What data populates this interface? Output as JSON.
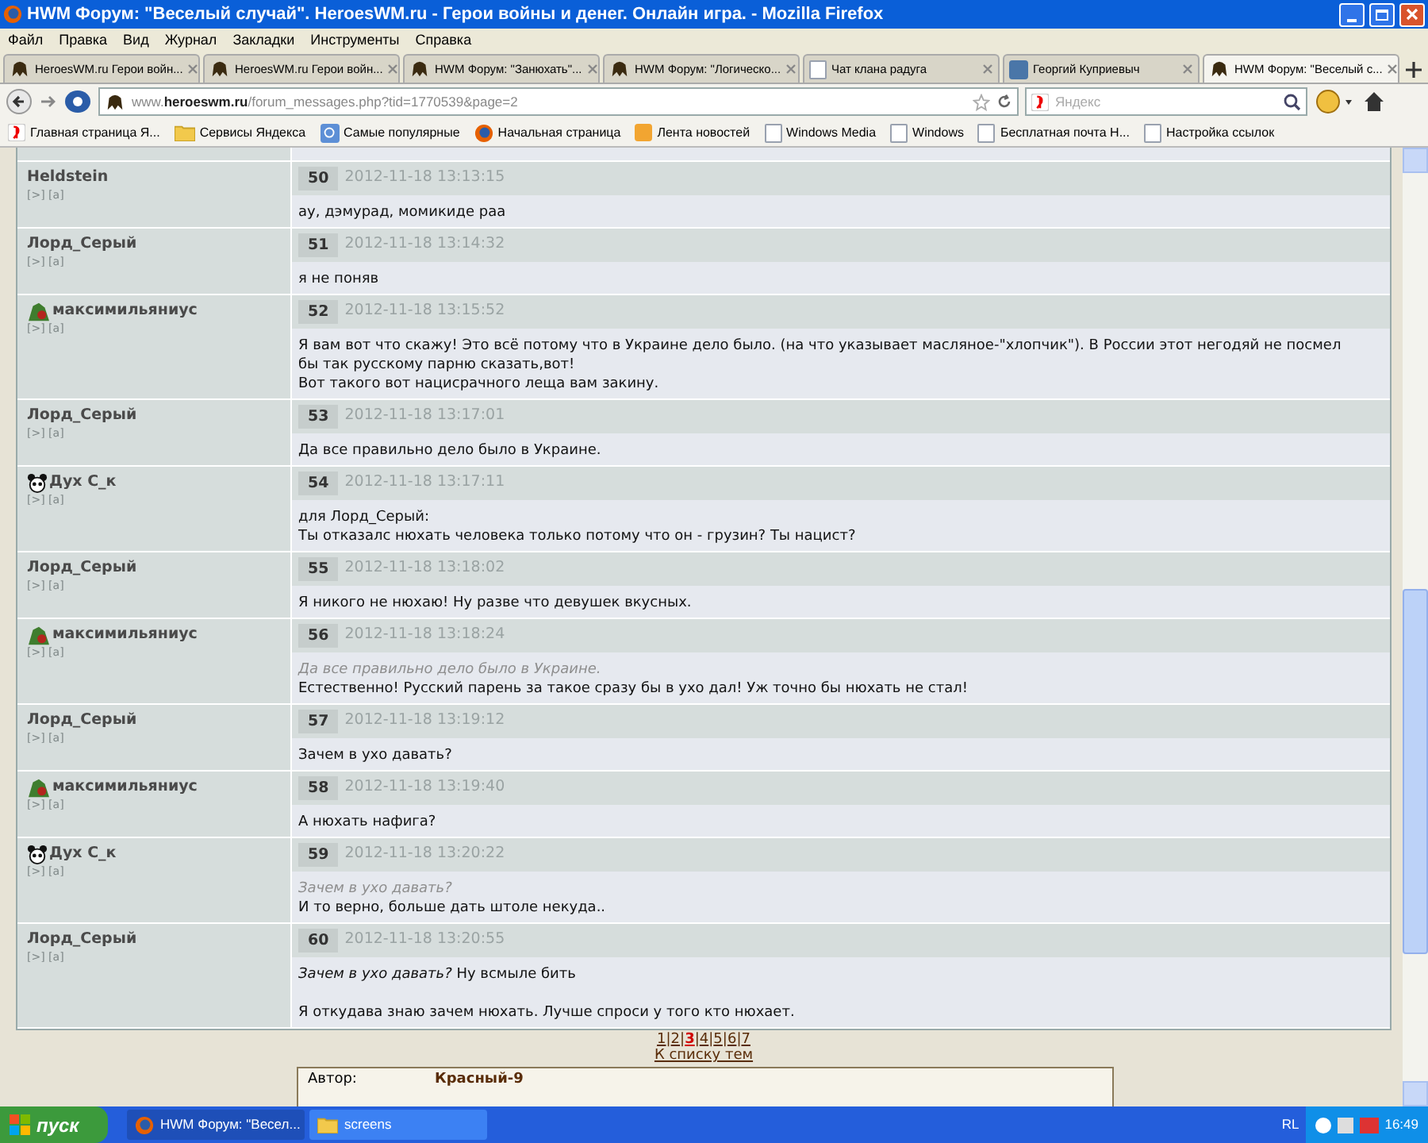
{
  "window": {
    "title": "HWM Форум: \"Веселый случай\". HeroesWM.ru - Герои войны и денег. Онлайн игра. - Mozilla Firefox"
  },
  "menu": [
    "Файл",
    "Правка",
    "Вид",
    "Журнал",
    "Закладки",
    "Инструменты",
    "Справка"
  ],
  "tabs": [
    {
      "label": "HeroesWM.ru Герои войн...",
      "kind": "game",
      "selected": false
    },
    {
      "label": "HeroesWM.ru Герои войн...",
      "kind": "game",
      "selected": false
    },
    {
      "label": "HWM Форум: \"Занюхать\"...",
      "kind": "game",
      "selected": false
    },
    {
      "label": "HWM Форум: \"Логическо...",
      "kind": "game",
      "selected": false
    },
    {
      "label": "Чат клана радуга",
      "kind": "blank",
      "selected": false
    },
    {
      "label": "Георгий Куприевыч",
      "kind": "vk",
      "selected": false
    },
    {
      "label": "HWM Форум: \"Веселый с...",
      "kind": "game",
      "selected": true
    }
  ],
  "address": {
    "domain_prefix": "www.",
    "domain": "heroeswm.ru",
    "path": "/forum_messages.php?tid=1770539&page=2"
  },
  "search": {
    "placeholder": "Яндекс"
  },
  "bookmarks": [
    {
      "label": "Главная страница Я...",
      "kind": "yandex"
    },
    {
      "label": "Сервисы Яндекса",
      "kind": "folder"
    },
    {
      "label": "Самые популярные",
      "kind": "search"
    },
    {
      "label": "Начальная страница",
      "kind": "firefox"
    },
    {
      "label": "Лента новостей",
      "kind": "rss"
    },
    {
      "label": "Windows Media",
      "kind": "blank"
    },
    {
      "label": "Windows",
      "kind": "blank"
    },
    {
      "label": "Бесплатная почта Н...",
      "kind": "blank"
    },
    {
      "label": "Настройка ссылок",
      "kind": "blank"
    }
  ],
  "posts": [
    {
      "author": "Heldstein",
      "kind": "plain",
      "links": "[>] [a]",
      "number": "50",
      "date": "2012-11-18 13:13:15",
      "lines": [
        {
          "kind": "text",
          "text": "ау, дэмурад, момикиде раа"
        }
      ]
    },
    {
      "author": "Лорд_Серый",
      "kind": "plain",
      "links": "[>] [a]",
      "number": "51",
      "date": "2012-11-18 13:14:32",
      "lines": [
        {
          "kind": "text",
          "text": "я не поняв"
        }
      ]
    },
    {
      "author": "максимильяниус",
      "kind": "warrior",
      "links": "[>] [a]",
      "number": "52",
      "date": "2012-11-18 13:15:52",
      "lines": [
        {
          "kind": "text",
          "text": "Я вам вот что скажу! Это всё потому что в Украине дело было. (на что указывает масляное-\"хлопчик\"). В России этот негодяй не посмел"
        },
        {
          "kind": "text",
          "text": "бы так русскому парню сказать,вот!"
        },
        {
          "kind": "text",
          "text": "Вот такого вот нацисрачного леща вам закину."
        }
      ]
    },
    {
      "author": "Лорд_Серый",
      "kind": "plain",
      "links": "[>] [a]",
      "number": "53",
      "date": "2012-11-18 13:17:01",
      "lines": [
        {
          "kind": "text",
          "text": "Да все правильно дело было в Украине."
        }
      ]
    },
    {
      "author": "Дух С_к",
      "kind": "panda",
      "links": "[>] [a]",
      "number": "54",
      "date": "2012-11-18 13:17:11",
      "lines": [
        {
          "kind": "text",
          "text": "для Лорд_Серый:"
        },
        {
          "kind": "text",
          "text": "Ты отказалс нюхать человека только потому что он - грузин? Ты нацист?"
        }
      ]
    },
    {
      "author": "Лорд_Серый",
      "kind": "plain",
      "links": "[>] [a]",
      "number": "55",
      "date": "2012-11-18 13:18:02",
      "lines": [
        {
          "kind": "text",
          "text": "Я никого не нюхаю! Ну разве что девушек вкусных."
        }
      ]
    },
    {
      "author": "максимильяниус",
      "kind": "warrior",
      "links": "[>] [a]",
      "number": "56",
      "date": "2012-11-18 13:18:24",
      "lines": [
        {
          "kind": "quote",
          "text": "Да все правильно дело было в Украине."
        },
        {
          "kind": "text",
          "text": "Естественно! Русский парень за такое сразу бы в ухо дал! Уж точно бы нюхать не стал!"
        }
      ]
    },
    {
      "author": "Лорд_Серый",
      "kind": "plain",
      "links": "[>] [a]",
      "number": "57",
      "date": "2012-11-18 13:19:12",
      "lines": [
        {
          "kind": "text",
          "text": "Зачем в ухо давать?"
        }
      ]
    },
    {
      "author": "максимильяниус",
      "kind": "warrior",
      "links": "[>] [a]",
      "number": "58",
      "date": "2012-11-18 13:19:40",
      "lines": [
        {
          "kind": "text",
          "text": "А нюхать нафига?"
        }
      ]
    },
    {
      "author": "Дух С_к",
      "kind": "panda",
      "links": "[>] [a]",
      "number": "59",
      "date": "2012-11-18 13:20:22",
      "lines": [
        {
          "kind": "quote",
          "text": "Зачем в ухо давать?"
        },
        {
          "kind": "text",
          "text": "И то верно, больше дать штоле некуда.."
        }
      ]
    },
    {
      "author": "Лорд_Серый",
      "kind": "plain",
      "links": "[>] [a]",
      "number": "60",
      "date": "2012-11-18 13:20:55",
      "lines": [
        {
          "kind": "text",
          "text": "*Зачем в ухо давать?* Ну всмыле бить"
        },
        {
          "kind": "gap"
        },
        {
          "kind": "text",
          "text": "Я откудава знаю зачем нюхать. Лучше спроси у того кто нюхает."
        }
      ]
    }
  ],
  "pagination": {
    "pages": [
      {
        "label": "1",
        "selected": false
      },
      {
        "label": "2",
        "selected": false
      },
      {
        "label": "3",
        "selected": true
      },
      {
        "label": "4",
        "selected": false
      },
      {
        "label": "5",
        "selected": false
      },
      {
        "label": "6",
        "selected": false
      },
      {
        "label": "7",
        "selected": false
      }
    ],
    "separator": "|",
    "back_link": "К списку тем"
  },
  "reply_form": {
    "author_label": "Автор:",
    "author": "Красный-9"
  },
  "taskbar": {
    "start": "пуск",
    "tasks": [
      {
        "label": "HWM Форум: \"Весел...",
        "kind": "firefox",
        "selected": true
      },
      {
        "label": "screens",
        "kind": "folder",
        "selected": false
      }
    ],
    "language": "RL",
    "time": "16:49"
  }
}
